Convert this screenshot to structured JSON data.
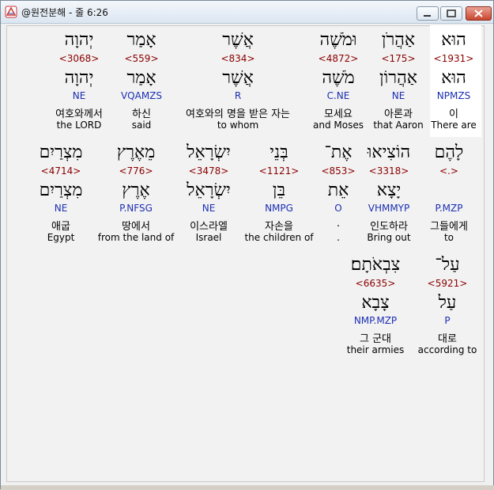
{
  "window": {
    "title": "@원전분해 - 줄 6:26"
  },
  "rows": [
    [
      {
        "hebrew": "הוּא",
        "code": "<1931>",
        "root": "הוּא",
        "morph": "NPMZS",
        "korean": "이",
        "english": "There are"
      },
      {
        "hebrew": "אַהֲרֹן",
        "code": "<175>",
        "root": "אַהֲרוֹן",
        "morph": "NE",
        "korean": "아론과",
        "english": "that Aaron"
      },
      {
        "hebrew": "וּמֹשֶׁה",
        "code": "<4872>",
        "root": "מֹשֶׁה",
        "morph": "C.NE",
        "korean": "모세요",
        "english": "and Moses"
      },
      {
        "hebrew": "אֲשֶׁר",
        "code": "<834>",
        "root": "אֲשֶׁר",
        "morph": "R",
        "korean": "여호와의 명을 받은 자는",
        "english": "to whom"
      },
      {
        "hebrew": "אָמַר",
        "code": "<559>",
        "root": "אָמַר",
        "morph": "VQAMZS",
        "korean": "하신",
        "english": "said"
      },
      {
        "hebrew": "יְהוָה",
        "code": "<3068>",
        "root": "יְהוָה",
        "morph": "NE",
        "korean": "여호와께서",
        "english": "the LORD"
      }
    ],
    [
      {
        "hebrew": "לָהֶם",
        "code": "<.>",
        "root": "",
        "morph": "P.MZP",
        "korean": "그들에게",
        "english": "to"
      },
      {
        "hebrew": "הוֹצִיאוּ",
        "code": "<3318>",
        "root": "יָצָא",
        "morph": "VHMMYP",
        "korean": "인도하라",
        "english": "Bring out"
      },
      {
        "hebrew": "אֶת־",
        "code": "<853>",
        "root": "אֵת",
        "morph": "O",
        "korean": ".",
        "english": "."
      },
      {
        "hebrew": "בְּנֵי",
        "code": "<1121>",
        "root": "בֵּן",
        "morph": "NMPG",
        "korean": "자손을",
        "english": "the children of"
      },
      {
        "hebrew": "יִשְׂרָאֵל",
        "code": "<3478>",
        "root": "יִשְׂרָאֵל",
        "morph": "NE",
        "korean": "이스라엘",
        "english": "Israel"
      },
      {
        "hebrew": "מֵאֶרֶץ",
        "code": "<776>",
        "root": "אֶרֶץ",
        "morph": "P.NFSG",
        "korean": "땅에서",
        "english": "from the land of"
      },
      {
        "hebrew": "מִצְרַיִם",
        "code": "<4714>",
        "root": "מִצְרַיִם",
        "morph": "NE",
        "korean": "애굽",
        "english": "Egypt"
      }
    ],
    [
      {
        "hebrew": "עַל־",
        "code": "<5921>",
        "root": "עַל",
        "morph": "P",
        "korean": "대로",
        "english": "according to"
      },
      {
        "hebrew": "צִבְאֹתָם׃",
        "code": "<6635>",
        "root": "צָבָא",
        "morph": "NMP.MZP",
        "korean": "그 군대",
        "english": "their armies"
      }
    ]
  ]
}
